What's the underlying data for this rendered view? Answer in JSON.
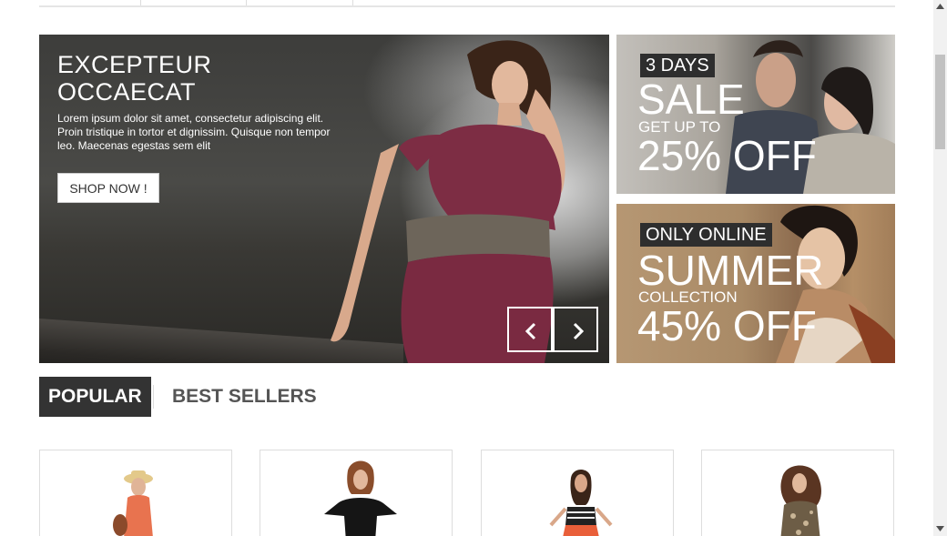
{
  "hero": {
    "title_line1": "EXCEPTEUR",
    "title_line2": "OCCAECAT",
    "text": "Lorem ipsum dolor sit amet, consectetur adipiscing elit. Proin tristique in tortor et dignissim. Quisque non tempor leo. Maecenas egestas sem elit",
    "button_label": "SHOP NOW !",
    "nav_prev_icon": "chevron-left-icon",
    "nav_next_icon": "chevron-right-icon"
  },
  "promo_sale": {
    "tag": "3 DAYS",
    "headline": "SALE",
    "subline": "GET UP TO",
    "offer": "25% OFF"
  },
  "promo_summer": {
    "tag": "ONLY ONLINE",
    "headline": "SUMMER",
    "subline": "COLLECTION",
    "offer": "45% OFF"
  },
  "tabs": [
    {
      "label": "POPULAR",
      "active": true
    },
    {
      "label": "BEST SELLERS",
      "active": false
    }
  ],
  "products": [
    {
      "name": "product-1"
    },
    {
      "name": "product-2"
    },
    {
      "name": "product-3"
    },
    {
      "name": "product-4"
    }
  ],
  "colors": {
    "dark": "#333333",
    "tab_inactive_text": "#555555",
    "border": "#dddddd",
    "white": "#ffffff"
  }
}
